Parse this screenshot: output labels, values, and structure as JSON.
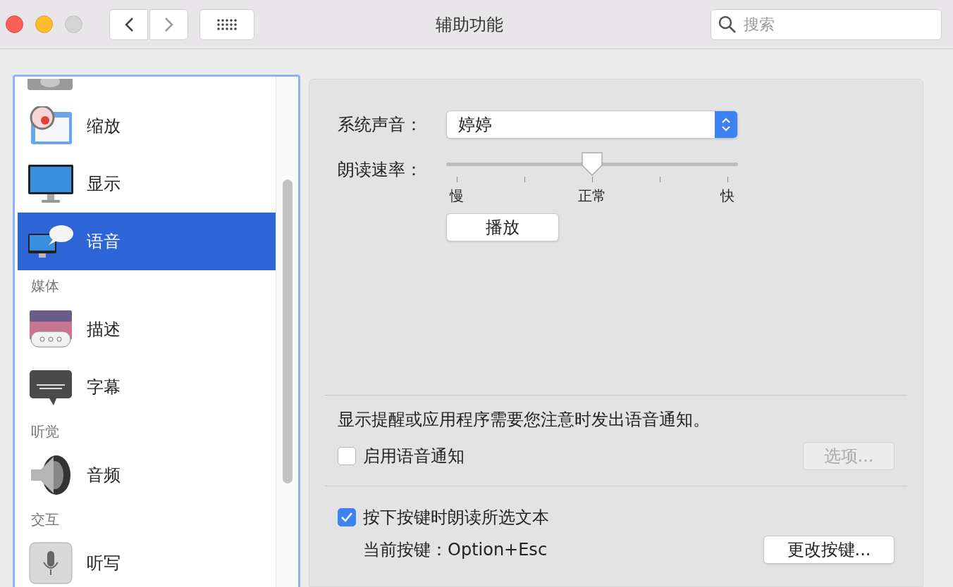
{
  "window": {
    "title": "辅助功能"
  },
  "search": {
    "placeholder": "搜索"
  },
  "sidebar": {
    "items": [
      {
        "kind": "partial"
      },
      {
        "kind": "item",
        "label": "缩放",
        "selected": false
      },
      {
        "kind": "item",
        "label": "显示",
        "selected": false
      },
      {
        "kind": "item",
        "label": "语音",
        "selected": true
      },
      {
        "kind": "header",
        "label": "媒体"
      },
      {
        "kind": "item",
        "label": "描述",
        "selected": false
      },
      {
        "kind": "item",
        "label": "字幕",
        "selected": false
      },
      {
        "kind": "header",
        "label": "听觉"
      },
      {
        "kind": "item",
        "label": "音频",
        "selected": false
      },
      {
        "kind": "header",
        "label": "交互"
      },
      {
        "kind": "item",
        "label": "听写",
        "selected": false
      }
    ]
  },
  "speech": {
    "voice_label": "系统声音：",
    "voice": "婷婷",
    "rate_label": "朗读速率：",
    "rate": {
      "level": 0.5
    },
    "rate_ticks": [
      "慢",
      "正常",
      "快"
    ],
    "play_button": "播放"
  },
  "announcements": {
    "text": "显示提醒或应用程序需要您注意时发出语音通知。",
    "checkbox": {
      "label": "启用语音通知",
      "checked": false
    },
    "options_button": {
      "label": "选项...",
      "disabled": true
    }
  },
  "speak_selected": {
    "checkbox": {
      "label": "按下按键时朗读所选文本",
      "checked": true
    },
    "key_label": "当前按键：",
    "key": "Option+Esc",
    "change_button": "更改按键..."
  }
}
